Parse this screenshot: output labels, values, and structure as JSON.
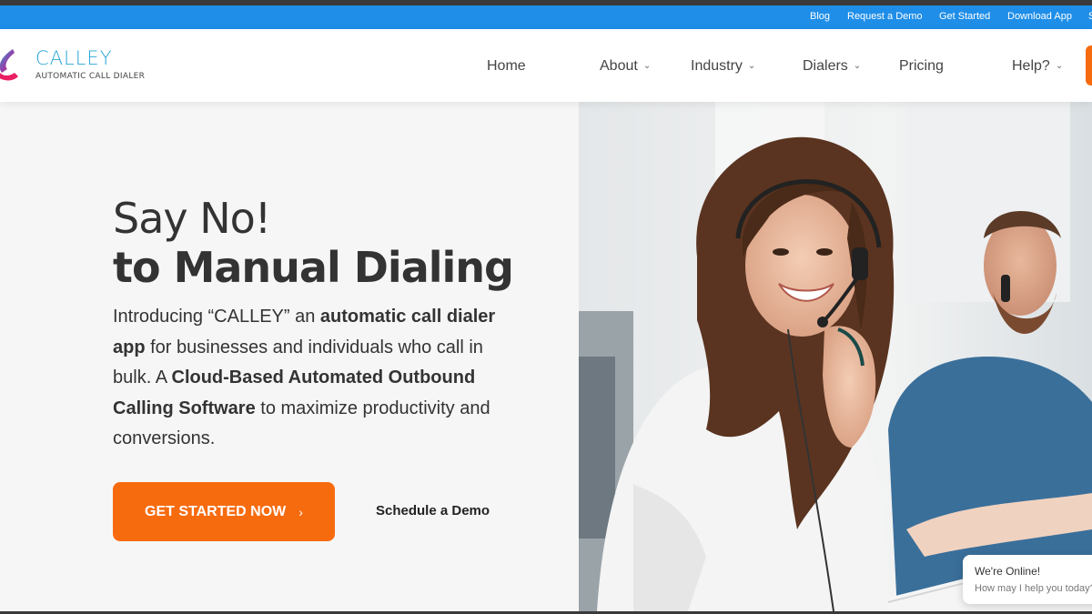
{
  "topbar": {
    "links": [
      "Blog",
      "Request a Demo",
      "Get Started",
      "Download App",
      "S"
    ]
  },
  "brand": {
    "name": "CALLEY",
    "tagline": "AUTOMATIC CALL DIALER"
  },
  "nav": {
    "home": "Home",
    "about": "About",
    "industry": "Industry",
    "dialers": "Dialers",
    "pricing": "Pricing",
    "help": "Help?",
    "chevron": "⌄"
  },
  "hero": {
    "title_line1": "Say No!",
    "title_line2_prefix": "to ",
    "title_line2_bold": "Manual Dialing",
    "desc": {
      "p1": "Introducing “CALLEY” an ",
      "b1": "automatic call dialer app",
      "p2": " for businesses and individuals who call in bulk. A ",
      "b2": "Cloud-Based Automated Outbound Calling Software",
      "p3": " to maximize productivity and conversions."
    },
    "cta_label": "GET STARTED NOW",
    "cta_arrow": "›",
    "demo_label": "Schedule a Demo"
  },
  "chat": {
    "title": "We're Online!",
    "subtitle": "How may I help you today?"
  },
  "colors": {
    "topbar": "#1f8ee8",
    "accent": "#f76b0f",
    "brand": "#2aa6d6"
  }
}
